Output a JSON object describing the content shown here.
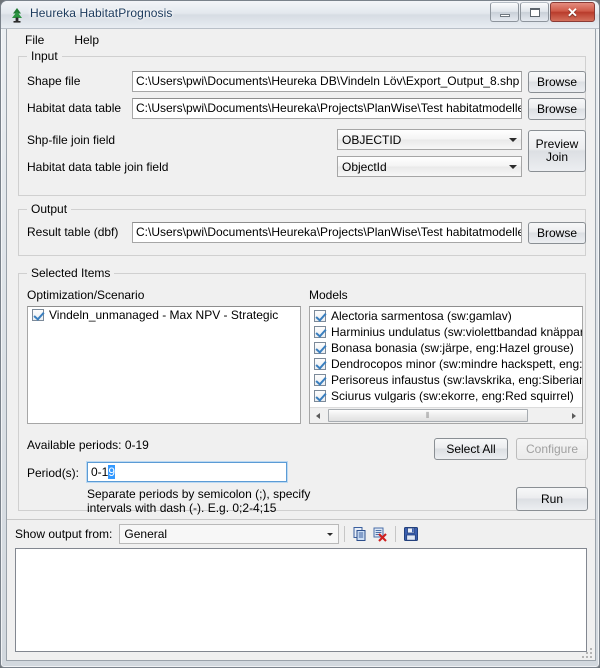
{
  "window": {
    "title": "Heureka HabitatPrognosis",
    "icon": "tree-icon",
    "controls": {
      "minimize": "Minimize",
      "maximize": "Maximize",
      "close": "Close"
    }
  },
  "menu": {
    "items": [
      {
        "label": "File",
        "name": "menu-file"
      },
      {
        "label": "Help",
        "name": "menu-help"
      }
    ]
  },
  "input": {
    "group_title": "Input",
    "shape_file": {
      "label": "Shape file",
      "value": "C:\\Users\\pwi\\Documents\\Heureka DB\\Vindeln Löv\\Export_Output_8.shp",
      "browse_label": "Browse"
    },
    "habitat_data_table": {
      "label": "Habitat data table",
      "value": "C:\\Users\\pwi\\Documents\\Heureka\\Projects\\PlanWise\\Test habitatmodeller\\Vindeln_un",
      "browse_label": "Browse"
    },
    "shp_join_field": {
      "label": "Shp-file join field",
      "value": "OBJECTID"
    },
    "habitat_join_field": {
      "label": "Habitat data table join field",
      "value": "ObjectId"
    },
    "preview_join_label": "Preview\nJoin",
    "preview_join_line1": "Preview",
    "preview_join_line2": "Join"
  },
  "output": {
    "group_title": "Output",
    "result_table": {
      "label": "Result table (dbf)",
      "value": "C:\\Users\\pwi\\Documents\\Heureka\\Projects\\PlanWise\\Test habitatmodeller\\res_habmo",
      "browse_label": "Browse"
    }
  },
  "selected_items": {
    "group_title": "Selected Items",
    "optimization": {
      "label": "Optimization/Scenario",
      "items": [
        {
          "label": "Vindeln_unmanaged - Max NPV - Strategic",
          "checked": true
        }
      ]
    },
    "models": {
      "label": "Models",
      "items": [
        {
          "label": "Alectoria sarmentosa (sw:gamlav)",
          "checked": true
        },
        {
          "label": "Harminius undulatus (sw:violettbandad knäppare)",
          "checked": true
        },
        {
          "label": "Bonasa bonasia (sw:järpe, eng:Hazel grouse)",
          "checked": true
        },
        {
          "label": "Dendrocopos minor (sw:mindre hackspett, eng:Lesser spotte",
          "checked": true
        },
        {
          "label": "Perisoreus infaustus (sw:lavskrika, eng:Siberian jay)",
          "checked": true
        },
        {
          "label": "Sciurus vulgaris (sw:ekorre, eng:Red squirrel)",
          "checked": true
        }
      ]
    }
  },
  "periods": {
    "available_label": "Available periods: 0-19",
    "field_label": "Period(s):",
    "value_prefix": "0-1",
    "value_selected": "9",
    "hint_line1": "Separate periods by semicolon (;), specify",
    "hint_line2": "intervals with dash (-). E.g. 0;2-4;15"
  },
  "actions": {
    "select_all": "Select All",
    "configure": "Configure",
    "run": "Run"
  },
  "output_panel": {
    "show_output_label": "Show output from:",
    "source_value": "General",
    "toolbar": [
      {
        "name": "copy-icon",
        "title": "Copy"
      },
      {
        "name": "clear-output-icon",
        "title": "Clear output"
      },
      {
        "name": "save-icon",
        "title": "Save"
      }
    ],
    "text": ""
  },
  "colors": {
    "accent": "#3399ff",
    "face": "#f0f0f0",
    "close_button": "#b93c2c",
    "check": "#3a7fbf"
  }
}
